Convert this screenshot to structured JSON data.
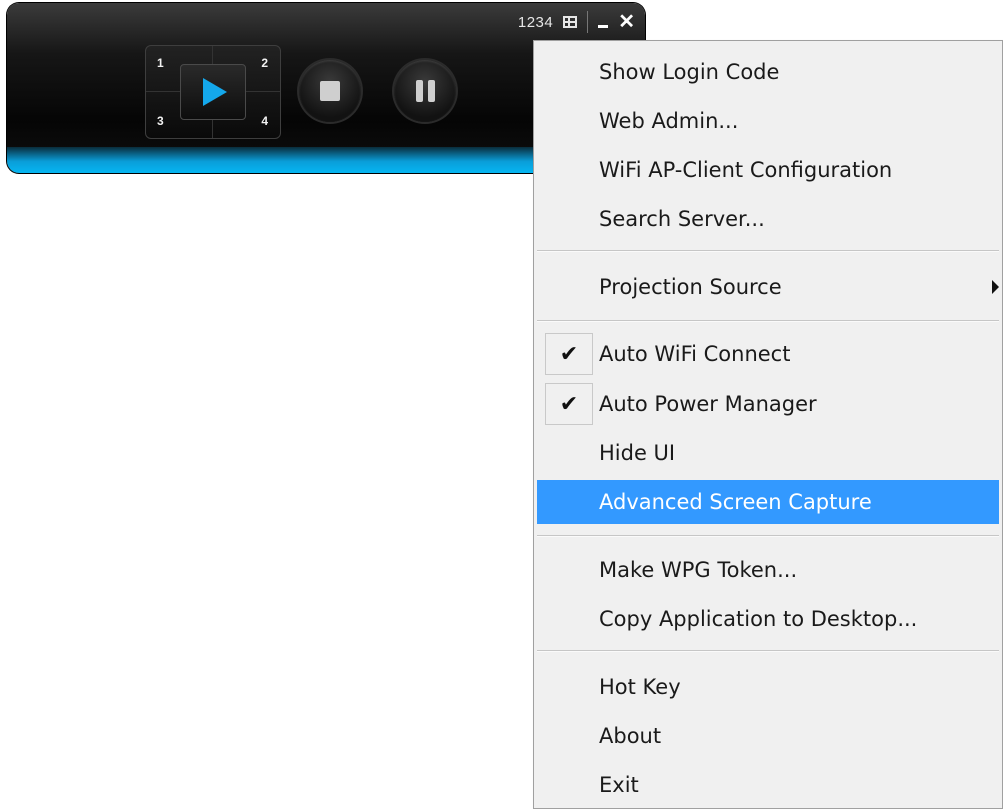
{
  "player": {
    "login_code": "1234",
    "quadrants": [
      "1",
      "2",
      "3",
      "4"
    ],
    "buttons": {
      "play": "play-icon",
      "stop": "stop-icon",
      "pause": "pause-icon"
    },
    "accent_color": "#0aa8ec"
  },
  "menu": {
    "items": [
      {
        "label": "Show Login Code"
      },
      {
        "label": "Web Admin..."
      },
      {
        "label": "WiFi AP-Client Configuration"
      },
      {
        "label": "Search Server..."
      },
      {
        "label": "Projection Source",
        "submenu": true
      },
      {
        "label": "Auto WiFi Connect",
        "checked": true
      },
      {
        "label": "Auto Power Manager",
        "checked": true
      },
      {
        "label": "Hide UI"
      },
      {
        "label": "Advanced Screen Capture",
        "highlighted": true
      },
      {
        "label": "Make WPG Token..."
      },
      {
        "label": "Copy Application to Desktop..."
      },
      {
        "label": "Hot Key"
      },
      {
        "label": "About"
      },
      {
        "label": "Exit"
      }
    ],
    "highlight_color": "#3399ff",
    "check_glyph": "✔"
  }
}
